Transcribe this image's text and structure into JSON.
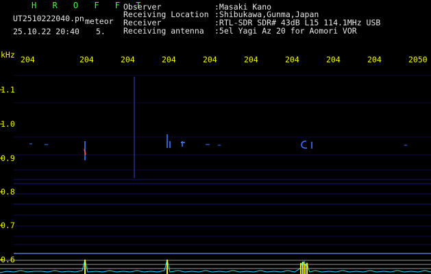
{
  "header": {
    "program": "H R O F F T",
    "filename": "UT2510222040.pn",
    "mode": "meteor",
    "datetime": "25.10.22 20:40",
    "count": "5."
  },
  "meta": [
    {
      "label": "Observer",
      "value": ":Masaki Kano"
    },
    {
      "label": "Receiving Location",
      "value": ":Shibukawa,Gunma,Japan"
    },
    {
      "label": "Receiver",
      "value": ":RTL-SDR SDR# 43dB L15 114.1MHz USB"
    },
    {
      "label": "Receiving antenna",
      "value": ":5el Yagi Az 20 for Aomori VOR"
    }
  ],
  "axis": {
    "y_unit": "kHz",
    "x_ticks": [
      "204",
      "204",
      "204",
      "204",
      "204",
      "204",
      "204",
      "204",
      "204",
      "2050"
    ],
    "y_ticks": [
      "1.1",
      "1.0",
      "0.9",
      "0.8",
      "0.7",
      "0.6"
    ]
  },
  "colors": {
    "background": "#000000",
    "noise": "#14148c",
    "echo": "#3c78ff",
    "spike": "#f4f400",
    "baseline": "#5a8cff",
    "text_label": "#f4f400"
  }
}
